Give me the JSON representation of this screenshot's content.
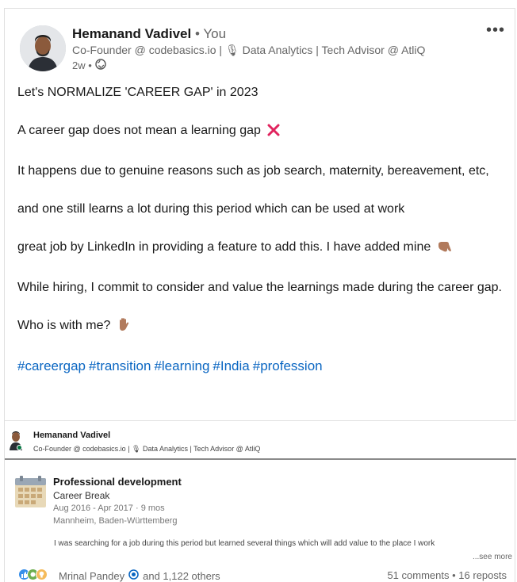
{
  "author": {
    "name": "Hemanand Vadivel",
    "you_badge": "• You",
    "headline": "Co-Founder @ codebasics.io | 🎙 Data Analytics | Tech Advisor @ AtliQ",
    "time": "2w •"
  },
  "menu": {
    "more_label": "•••"
  },
  "post": {
    "paragraphs": {
      "p1": "Let's NORMALIZE 'CAREER GAP' in 2023",
      "p2": "A career gap does not mean a learning gap",
      "p3": "It happens due to genuine reasons such as job search, maternity, bereavement, etc,",
      "p4": "and one still learns a lot during this period which can be used at work",
      "p5": "great job by LinkedIn in providing a feature to add this. I have added mine",
      "p6": "While hiring, I commit to consider and value the learnings made during the career gap.",
      "p7": "Who is with me?"
    },
    "hashtags": [
      "#careergap",
      "#transition",
      "#learning",
      "#India",
      "#profession"
    ]
  },
  "shared_update": {
    "name": "Hemanand Vadivel",
    "headline": "Co-Founder @ codebasics.io | 🎙 Data Analytics | Tech Advisor @ AtliQ",
    "title": "Professional development",
    "subtitle": "Career Break",
    "dates": "Aug 2016 - Apr 2017 · 9 mos",
    "location": "Mannheim, Baden-Württemberg",
    "description": "I was searching for a job during this period but learned several things which will add value to the place I work",
    "see_more": "...see more"
  },
  "social": {
    "reactor": "Mrinal Pandey",
    "others": "and 1,122 others",
    "comments": "51 comments",
    "separator": "•",
    "reposts": "16 reposts"
  },
  "colors": {
    "link_blue": "#0a66c2",
    "cross_red": "#e0245e",
    "skin_tone": "#b17a5c",
    "online_green": "#057642"
  }
}
